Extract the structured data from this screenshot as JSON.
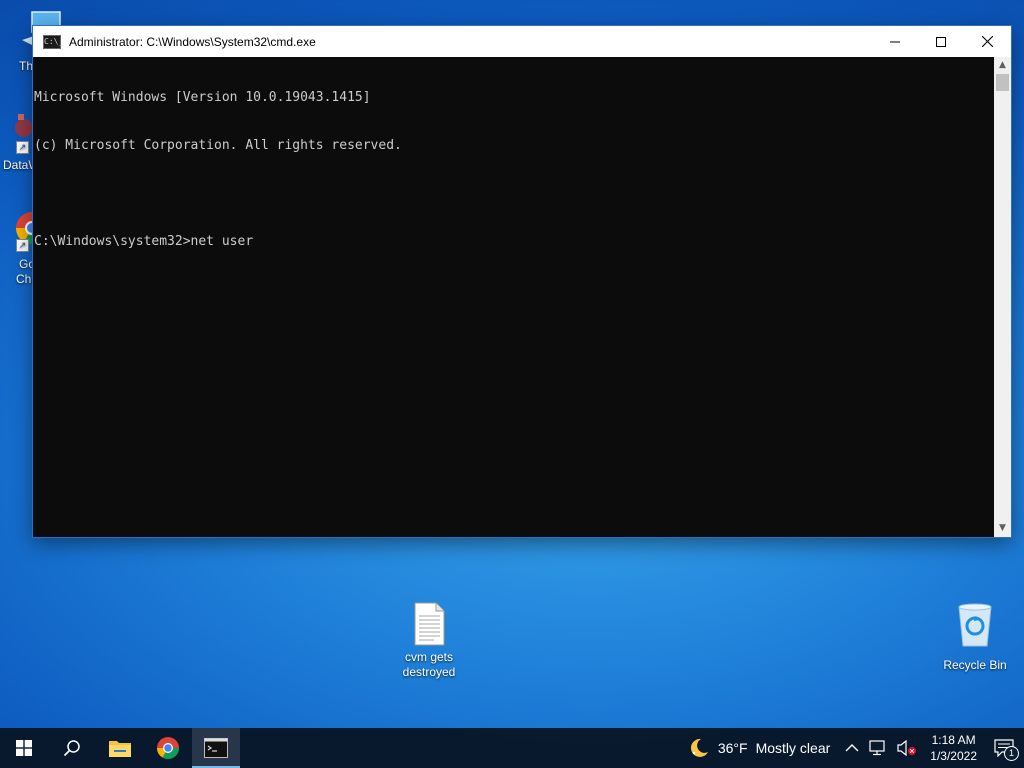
{
  "desktop": {
    "partial_icons": [
      {
        "label": "Th"
      },
      {
        "label": "DataW"
      },
      {
        "label_line1": "Go",
        "label_line2": "Chr"
      }
    ],
    "file_icon": {
      "line1": "cvm gets",
      "line2": "destroyed"
    },
    "recycle_bin": {
      "label": "Recycle Bin"
    }
  },
  "cmd_window": {
    "title": "Administrator: C:\\Windows\\System32\\cmd.exe",
    "app_icon_text": "C:\\_",
    "lines": [
      "Microsoft Windows [Version 10.0.19043.1415]",
      "(c) Microsoft Corporation. All rights reserved.",
      "",
      "C:\\Windows\\system32>net user"
    ],
    "colors": {
      "background": "#0c0c0c",
      "text": "#cccccc"
    }
  },
  "taskbar": {
    "weather": {
      "temp": "36°F",
      "condition": "Mostly clear",
      "icon": "moon-icon"
    },
    "clock": {
      "time": "1:18 AM",
      "date": "1/3/2022"
    },
    "notification_count": "1",
    "apps": [
      "start",
      "search",
      "file-explorer",
      "chrome",
      "cmd"
    ]
  }
}
